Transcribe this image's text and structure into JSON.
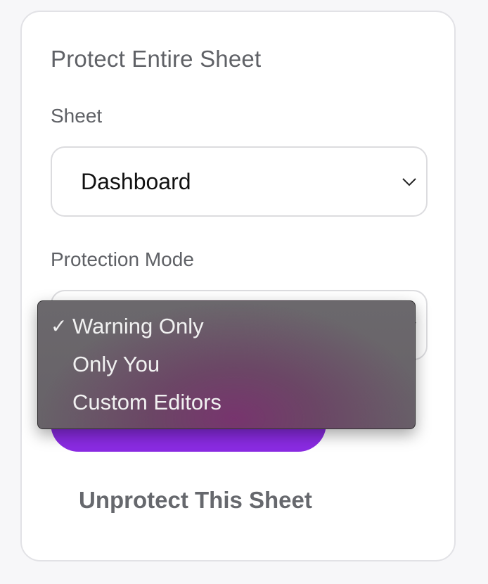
{
  "panel": {
    "title": "Protect Entire Sheet",
    "sheet_label": "Sheet",
    "sheet_value": "Dashboard",
    "mode_label": "Protection Mode",
    "unprotect_label": "Unprotect This Sheet"
  },
  "dropdown": {
    "check_mark": "✓",
    "options": [
      {
        "label": "Warning Only",
        "selected": true
      },
      {
        "label": "Only You",
        "selected": false
      },
      {
        "label": "Custom Editors",
        "selected": false
      }
    ]
  },
  "colors": {
    "accent": "#8a2be2",
    "text_muted": "#5f6166"
  },
  "icons": {
    "select_arrow": "chevron-down-icon",
    "selected_mark": "checkmark-icon"
  }
}
